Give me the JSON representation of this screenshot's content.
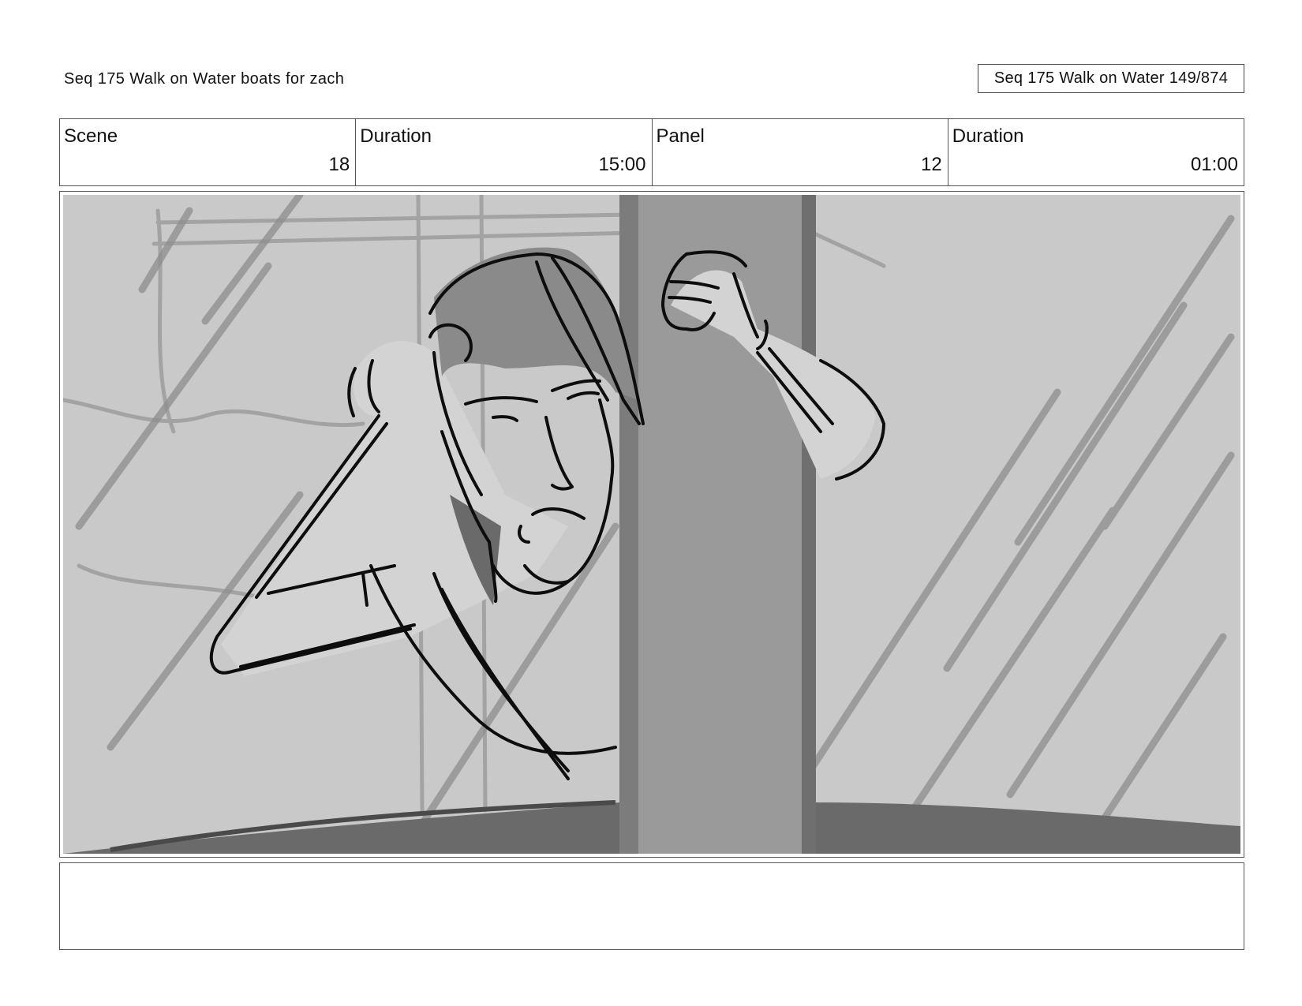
{
  "header": {
    "sequence_title": "Seq 175 Walk on Water  boats for zach",
    "page_indicator": "Seq 175 Walk on Water 149/874"
  },
  "info": {
    "scene_label": "Scene",
    "scene_value": "18",
    "scene_duration_label": "Duration",
    "scene_duration_value": "15:00",
    "panel_label": "Panel",
    "panel_value": "12",
    "panel_duration_label": "Duration",
    "panel_duration_value": "01:00"
  },
  "notes": {
    "text": ""
  },
  "colors": {
    "sketch_background": "#c9c9c9",
    "mast": "#9a9a9a",
    "ink": "#0d0d0d"
  }
}
